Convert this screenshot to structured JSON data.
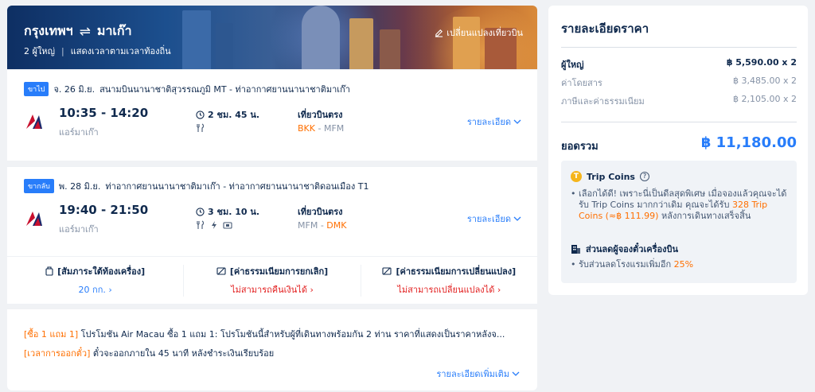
{
  "hero": {
    "origin": "กรุงเทพฯ",
    "destination": "มาเก๊า",
    "passengers": "2 ผู้ใหญ่",
    "time_note": "แสดงเวลาตามเวลาท้องถิ่น",
    "change_label": "เปลี่ยนแปลงเที่ยวบิน"
  },
  "flights": [
    {
      "tag": "ขาไป",
      "date": "จ. 26 มิ.ย.",
      "route": "สนามบินนานาชาติสุวรรณภูมิ MT - ท่าอากาศยานนานาชาติมาเก๊า",
      "times": "10:35 - 14:20",
      "airline": "แอร์มาเก๊า",
      "duration": "2 ชม. 45 น.",
      "direct": "เที่ยวบินตรง",
      "from_code": "BKK",
      "to_code": "MFM",
      "detail_label": "รายละเอียด"
    },
    {
      "tag": "ขากลับ",
      "date": "พ. 28 มิ.ย.",
      "route": "ท่าอากาศยานนานาชาติมาเก๊า - ท่าอากาศยานนานาชาติดอนเมือง T1",
      "times": "19:40 - 21:50",
      "airline": "แอร์มาเก๊า",
      "duration": "3 ชม. 10 น.",
      "direct": "เที่ยวบินตรง",
      "from_code": "MFM",
      "to_code": "DMK",
      "detail_label": "รายละเอียด"
    }
  ],
  "policies": [
    {
      "title": "[สัมภาระใต้ท้องเครื่อง]",
      "value": "20 กก."
    },
    {
      "title": "[ค่าธรรมเนียมการยกเลิก]",
      "value": "ไม่สามารถคืนเงินได้"
    },
    {
      "title": "[ค่าธรรมเนียมการเปลี่ยนแปลง]",
      "value": "ไม่สามารถเปลี่ยนแปลงได้"
    }
  ],
  "promo": {
    "line1_tag": "[ซื้อ 1 แถม 1]",
    "line1_text": " โปรโมชัน Air Macau ซื้อ 1 แถม 1: โปรโมชันนี้สำหรับผู้ที่เดินทางพร้อมกัน 2 ท่าน ราคาที่แสดงเป็นราคาหลังจ...",
    "line2_tag": "[เวลาการออกตั๋ว]",
    "line2_text": " ตั๋วจะออกภายใน 45 นาที หลังชำระเงินเรียบร้อย",
    "more_label": "รายละเอียดเพิ่มเติม"
  },
  "price": {
    "title": "รายละเอียดราคา",
    "adult_label": "ผู้ใหญ่",
    "adult_value": "฿ 5,590.00 x 2",
    "fare_label": "ค่าโดยสาร",
    "fare_value": "฿ 3,485.00 x 2",
    "tax_label": "ภาษีและค่าธรรมเนียม",
    "tax_value": "฿ 2,105.00 x 2",
    "total_label": "ยอดรวม",
    "total_value": "฿ 11,180.00"
  },
  "benefits": {
    "coins_title": "Trip Coins",
    "coins_text_1": "เลือกได้ดี! เพราะนี่เป็นดีลสุดพิเศษ เมื่อจองแล้วคุณจะได้รับ Trip Coins มากกว่าเดิม คุณจะได้รับ ",
    "coins_highlight": "328 Trip Coins (≈฿ 111.99)",
    "coins_text_2": " หลังการเดินทางเสร็จสิ้น",
    "discount_title": "ส่วนลดผู้จองตั๋วเครื่องบิน",
    "discount_text": "รับส่วนลดโรงแรมเพิ่มอีก ",
    "discount_highlight": "25%"
  },
  "colors": {
    "accent": "#287dfa",
    "orange": "#ff6f00",
    "red": "#e21f1f"
  }
}
